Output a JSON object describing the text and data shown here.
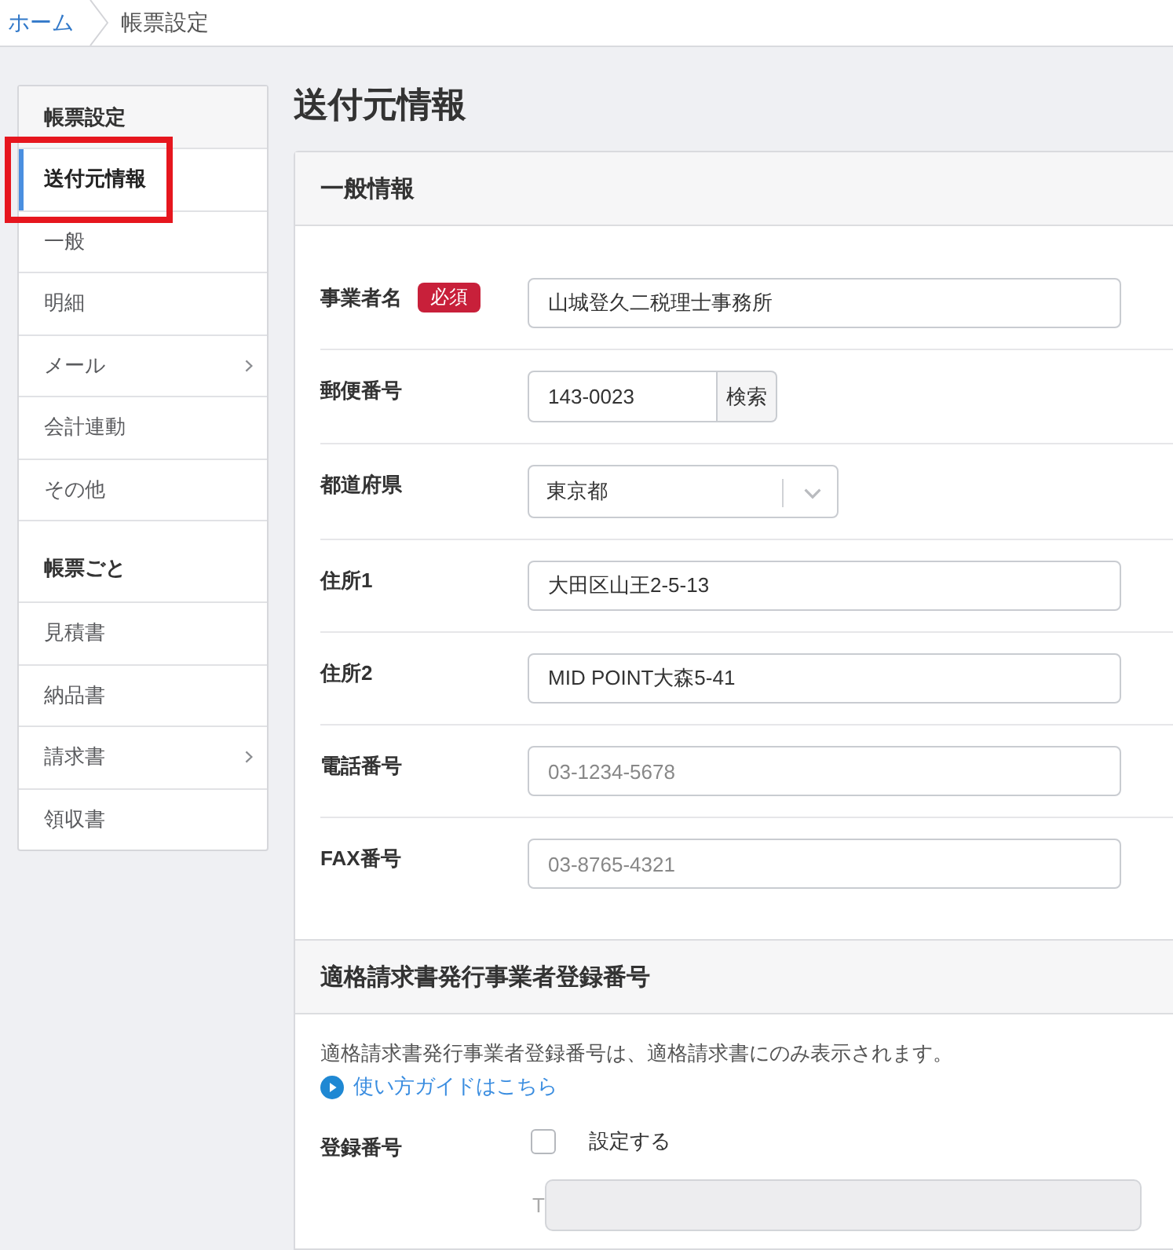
{
  "breadcrumb": [
    {
      "kind": "link",
      "label": "ホーム"
    },
    {
      "kind": "current",
      "label": "帳票設定"
    }
  ],
  "sidebar": {
    "sections": [
      {
        "title": "帳票設定",
        "items": [
          {
            "label": "送付元情報",
            "selected": true,
            "highlighted": true,
            "has_submenu": false
          },
          {
            "label": "一般",
            "selected": false,
            "highlighted": false,
            "has_submenu": false
          },
          {
            "label": "明細",
            "selected": false,
            "highlighted": false,
            "has_submenu": false
          },
          {
            "label": "メール",
            "selected": false,
            "highlighted": false,
            "has_submenu": true
          },
          {
            "label": "会計連動",
            "selected": false,
            "highlighted": false,
            "has_submenu": false
          },
          {
            "label": "その他",
            "selected": false,
            "highlighted": false,
            "has_submenu": false
          }
        ]
      },
      {
        "title": "帳票ごと",
        "items": [
          {
            "label": "見積書",
            "selected": false,
            "highlighted": false,
            "has_submenu": false
          },
          {
            "label": "納品書",
            "selected": false,
            "highlighted": false,
            "has_submenu": false
          },
          {
            "label": "請求書",
            "selected": false,
            "highlighted": false,
            "has_submenu": true
          },
          {
            "label": "領収書",
            "selected": false,
            "highlighted": false,
            "has_submenu": false
          }
        ]
      }
    ]
  },
  "page_title": "送付元情報",
  "sections": [
    {
      "title": "一般情報",
      "fields": [
        {
          "kind": "text",
          "label": "事業者名",
          "badge": "必須",
          "value": "山城登久二税理士事務所"
        },
        {
          "kind": "postal",
          "label": "郵便番号",
          "value": "143-0023",
          "button": "検索"
        },
        {
          "kind": "select",
          "label": "都道府県",
          "value": "東京都"
        },
        {
          "kind": "text",
          "label": "住所1",
          "value": "大田区山王2-5-13"
        },
        {
          "kind": "text",
          "label": "住所2",
          "value": "MID POINT大森5-41"
        },
        {
          "kind": "text",
          "label": "電話番号",
          "placeholder": "03-1234-5678"
        },
        {
          "kind": "text",
          "label": "FAX番号",
          "placeholder": "03-8765-4321"
        }
      ]
    },
    {
      "title": "適格請求書発行事業者登録番号",
      "note": "適格請求書発行事業者登録番号は、適格請求書にのみ表示されます。",
      "guide_link": "使い方ガイドはこちら",
      "fields": [
        {
          "kind": "registration",
          "label": "登録番号",
          "checkbox_label": "設定する",
          "checked": false,
          "prefix": "T",
          "disabled": true
        }
      ]
    }
  ]
}
